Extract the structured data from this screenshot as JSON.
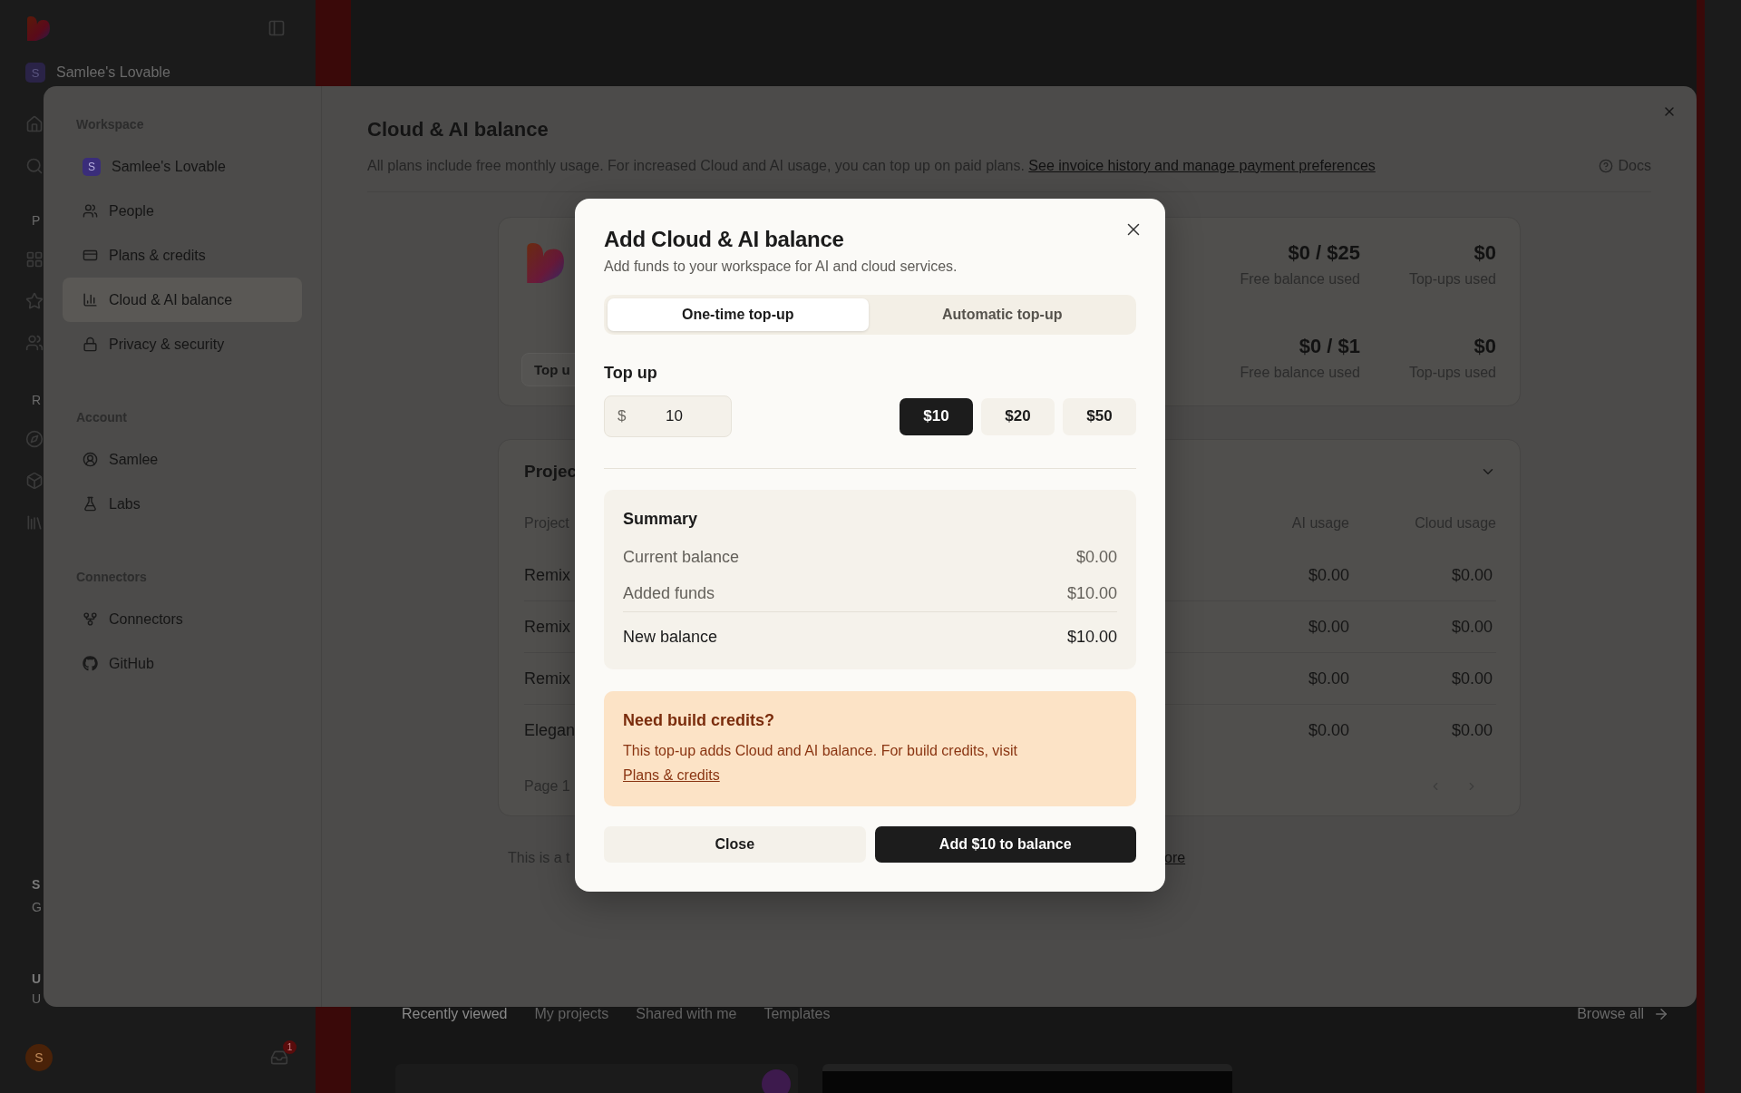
{
  "background_app": {
    "sidebar": {
      "workspace_initial": "S",
      "workspace_name": "Samlee's Lovable",
      "fragments": [
        "P",
        "R",
        "S",
        "G",
        "U",
        "U"
      ],
      "user_initial": "S",
      "inbox_badge": "1"
    },
    "tabs": [
      {
        "label": "Recently viewed",
        "selected": true
      },
      {
        "label": "My projects",
        "selected": false
      },
      {
        "label": "Shared with me",
        "selected": false
      },
      {
        "label": "Templates",
        "selected": false
      }
    ],
    "browse_all": "Browse all"
  },
  "settings": {
    "nav": [
      {
        "heading": "Workspace",
        "items": [
          {
            "label": "Samlee's Lovable",
            "kind": "avatar",
            "initial": "S",
            "selected": false
          },
          {
            "label": "People",
            "kind": "icon",
            "selected": false
          },
          {
            "label": "Plans & credits",
            "kind": "icon",
            "selected": false
          },
          {
            "label": "Cloud & AI balance",
            "kind": "icon",
            "selected": true
          },
          {
            "label": "Privacy & security",
            "kind": "icon",
            "selected": false
          }
        ]
      },
      {
        "heading": "Account",
        "items": [
          {
            "label": "Samlee",
            "kind": "icon",
            "selected": false
          },
          {
            "label": "Labs",
            "kind": "icon",
            "selected": false
          }
        ]
      },
      {
        "heading": "Connectors",
        "items": [
          {
            "label": "Connectors",
            "kind": "icon",
            "selected": false
          },
          {
            "label": "GitHub",
            "kind": "icon",
            "selected": false
          }
        ]
      }
    ],
    "title": "Cloud & AI balance",
    "description": "All plans include free monthly usage. For increased Cloud and AI usage, you can top up on paid plans.",
    "description_link": "See invoice history and manage payment preferences",
    "docs": "Docs",
    "balance_card": {
      "top_up_button": "Top u",
      "stats": [
        {
          "value": "$0 / $25",
          "label": "Free balance used"
        },
        {
          "value": "$0",
          "label": "Top-ups used"
        },
        {
          "value": "$0 / $1",
          "label": "Free balance used"
        },
        {
          "value": "$0",
          "label": "Top-ups used"
        }
      ]
    },
    "projects_card": {
      "title": "Projec",
      "columns": [
        "Project",
        "AI usage",
        "Cloud usage"
      ],
      "rows": [
        {
          "name": "Remix",
          "ai": "$0.00",
          "cloud": "$0.00"
        },
        {
          "name": "Remix",
          "ai": "$0.00",
          "cloud": "$0.00"
        },
        {
          "name": "Remix",
          "ai": "$0.00",
          "cloud": "$0.00"
        },
        {
          "name": "Elegan",
          "ai": "$0.00",
          "cloud": "$0.00"
        }
      ],
      "page": "Page 1"
    },
    "footnote": "This is a t",
    "footnote_link": "ore"
  },
  "dialog": {
    "title": "Add Cloud & AI balance",
    "subtitle": "Add funds to your workspace for AI and cloud services.",
    "tabs": [
      {
        "label": "One-time top-up",
        "selected": true
      },
      {
        "label": "Automatic top-up",
        "selected": false
      }
    ],
    "top_up_label": "Top up",
    "currency": "$",
    "amount": "10",
    "presets": [
      {
        "label": "$10",
        "selected": true
      },
      {
        "label": "$20",
        "selected": false
      },
      {
        "label": "$50",
        "selected": false
      }
    ],
    "summary": {
      "title": "Summary",
      "rows": [
        {
          "label": "Current balance",
          "value": "$0.00",
          "kind": "line"
        },
        {
          "label": "Added funds",
          "value": "$10.00",
          "kind": "line"
        },
        {
          "label": "New balance",
          "value": "$10.00",
          "kind": "total"
        }
      ]
    },
    "notice": {
      "title": "Need build credits?",
      "text": "This top-up adds Cloud and AI balance. For build credits, visit",
      "link": "Plans & credits"
    },
    "buttons": {
      "close": "Close",
      "confirm": "Add $10 to balance"
    }
  }
}
